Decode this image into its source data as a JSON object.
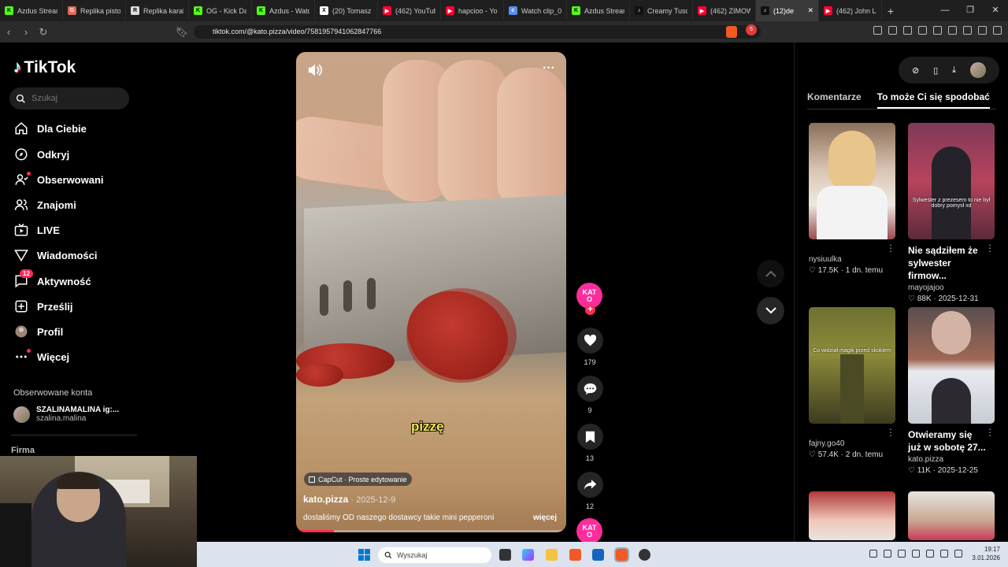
{
  "browser": {
    "tabs": [
      {
        "title": "Azdus Stream",
        "color": "#53fc18",
        "glyph": "K"
      },
      {
        "title": "Replika pistol",
        "color": "#e06a5a",
        "glyph": "G"
      },
      {
        "title": "Replika karab",
        "color": "#dddddd",
        "glyph": "R"
      },
      {
        "title": "OG - Kick Da",
        "color": "#53fc18",
        "glyph": "K"
      },
      {
        "title": "Azdus - Watc",
        "color": "#53fc18",
        "glyph": "K"
      },
      {
        "title": "(20) Tomasz S",
        "color": "#ffffff",
        "glyph": "X"
      },
      {
        "title": "(462) YouTub",
        "color": "#ff0033",
        "glyph": "▶"
      },
      {
        "title": "hapcioo - Yo",
        "color": "#ff0033",
        "glyph": "▶"
      },
      {
        "title": "Watch clip_0",
        "color": "#5b8def",
        "glyph": "c"
      },
      {
        "title": "Azdus Stream",
        "color": "#53fc18",
        "glyph": "K"
      },
      {
        "title": "Creamy Tusc",
        "color": "#111111",
        "glyph": "♪"
      },
      {
        "title": "(462) ZIMOW",
        "color": "#ff0033",
        "glyph": "▶"
      },
      {
        "title": "(12)de",
        "color": "#111111",
        "glyph": "♪"
      },
      {
        "title": "(462) John Lo",
        "color": "#ff0033",
        "glyph": "▶"
      }
    ],
    "active_tab_index": 12,
    "new_tab": "+",
    "url": "tiktok.com/@kato.pizza/video/7581957941062847766",
    "shield_count": "5"
  },
  "sidebar": {
    "logo": "TikTok",
    "search_placeholder": "Szukaj",
    "nav": [
      {
        "label": "Dla Ciebie",
        "icon": "home-icon"
      },
      {
        "label": "Odkryj",
        "icon": "compass-icon"
      },
      {
        "label": "Obserwowani",
        "icon": "following-icon"
      },
      {
        "label": "Znajomi",
        "icon": "friends-icon"
      },
      {
        "label": "LIVE",
        "icon": "live-icon"
      },
      {
        "label": "Wiadomości",
        "icon": "messages-icon"
      },
      {
        "label": "Aktywność",
        "icon": "activity-icon",
        "badge": "12"
      },
      {
        "label": "Prześlij",
        "icon": "upload-icon"
      },
      {
        "label": "Profil",
        "icon": "profile-icon"
      },
      {
        "label": "Więcej",
        "icon": "more-icon"
      }
    ],
    "followed_heading": "Obserwowane konta",
    "followed": [
      {
        "name": "SZALINAMALINA ig:...",
        "handle": "szalina.malina"
      }
    ],
    "company": "Firma"
  },
  "video": {
    "subtitle": "pizzę",
    "capcut": "CapCut · Proste edytowanie",
    "author": "kato.pizza",
    "date": "2025-12-9",
    "description": "dostaliśmy OD naszego dostawcy takie mini pepperoni",
    "more": "więcej",
    "progress": 0.14,
    "avatar_text": "KATO"
  },
  "actions": {
    "likes": "179",
    "comments": "9",
    "saves": "13",
    "shares": "12"
  },
  "right_panel": {
    "tabs": [
      "Komentarze",
      "To może Ci się spodobać"
    ],
    "active_tab": 1,
    "cards": [
      {
        "author": "nysiuulka",
        "title": "",
        "likes": "17.5K",
        "date": "1 dn. temu",
        "caption": ""
      },
      {
        "author": "mayojajoo",
        "title": "Nie sądziłem że sylwester firmow...",
        "likes": "88K",
        "date": "2025-12-31",
        "caption": "Sylwester z prezesem to nie był dobry pomysł xd"
      },
      {
        "author": "fajny.go40",
        "title": "",
        "likes": "57.4K",
        "date": "2 dn. temu",
        "caption": "Co widział magik przed skokiem"
      },
      {
        "author": "kato.pizza",
        "title": "Otwieramy się już w sobotę 27...",
        "likes": "11K",
        "date": "2025-12-25",
        "caption": ""
      }
    ]
  },
  "taskbar": {
    "search_placeholder": "Wyszukaj",
    "time": "19:17",
    "date": "3.01.2026"
  }
}
